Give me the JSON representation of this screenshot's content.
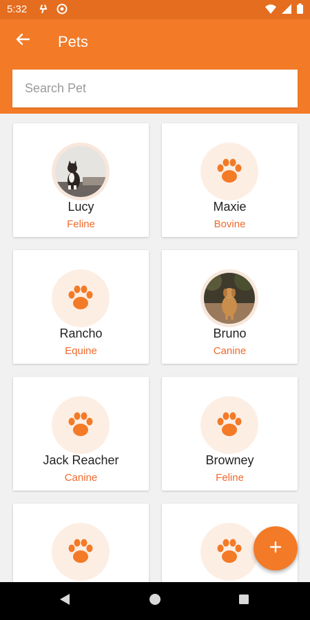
{
  "status_bar": {
    "time": "5:32"
  },
  "app_bar": {
    "title": "Pets"
  },
  "search": {
    "placeholder": "Search Pet",
    "value": ""
  },
  "pets": [
    {
      "name": "Lucy",
      "species": "Feline",
      "avatar": "cat-photo"
    },
    {
      "name": "Maxie",
      "species": "Bovine",
      "avatar": "paw-icon"
    },
    {
      "name": "Rancho",
      "species": "Equine",
      "avatar": "paw-icon"
    },
    {
      "name": "Bruno",
      "species": "Canine",
      "avatar": "dog-photo"
    },
    {
      "name": "Jack Reacher",
      "species": "Canine",
      "avatar": "paw-icon"
    },
    {
      "name": "Browney",
      "species": "Feline",
      "avatar": "paw-icon"
    },
    {
      "name": "",
      "species": "",
      "avatar": "paw-icon"
    },
    {
      "name": "",
      "species": "",
      "avatar": "paw-icon"
    }
  ],
  "fab": {
    "icon": "plus-icon"
  },
  "colors": {
    "primary": "#f37a27",
    "status_bar": "#e56d1f",
    "species_text": "#ee6a2c",
    "avatar_bg": "#fdeee4"
  }
}
